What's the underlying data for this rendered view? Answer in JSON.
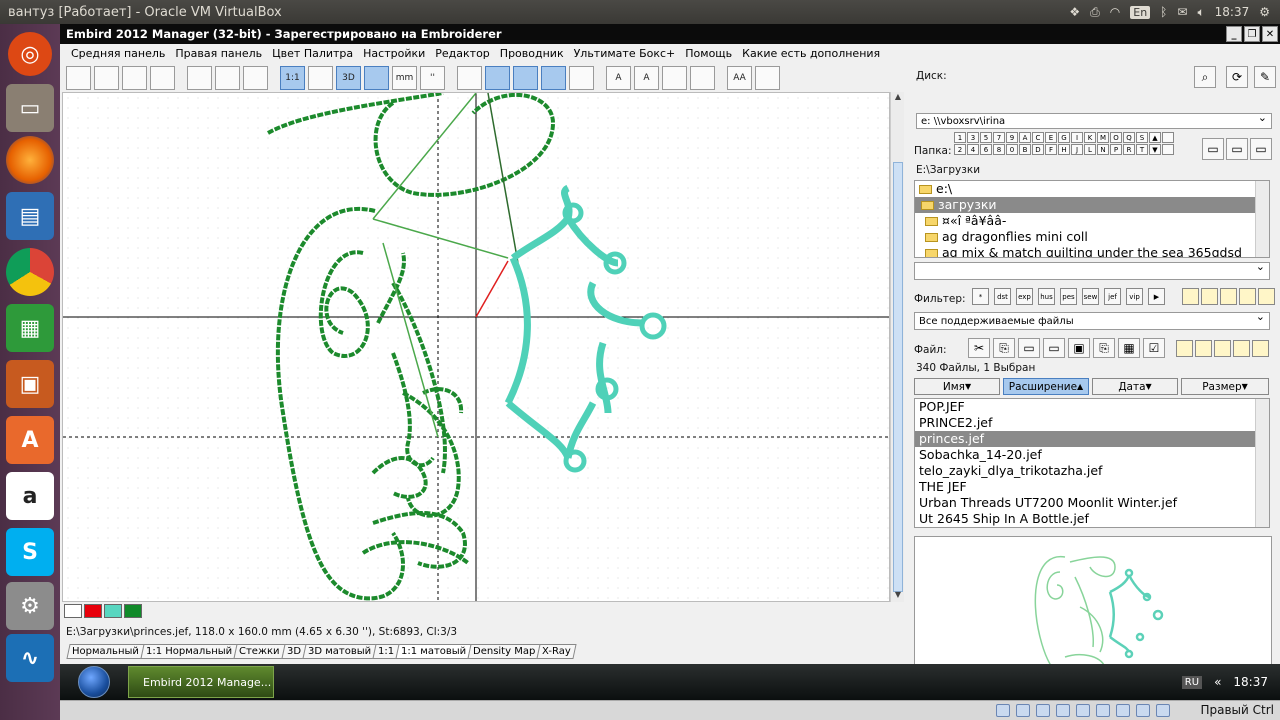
{
  "topbar": {
    "title": "вантуз [Работает] - Oracle VM VirtualBox",
    "keyboard_layout": "En",
    "clock": "18:37"
  },
  "launcher": {
    "apps": [
      "ubuntu-dash-icon",
      "files-icon",
      "firefox-icon",
      "writer-icon",
      "chrome-icon",
      "calc-icon",
      "impress-icon",
      "software-center-icon",
      "amazon-icon",
      "skype-icon",
      "settings-icon",
      "system-monitor-icon"
    ]
  },
  "app": {
    "title": "Embird 2012 Manager (32-bit) - Зарегестрировано на Embroiderer",
    "menu": [
      "Средняя панель",
      "Правая панель",
      "Цвет Палитра",
      "Настройки",
      "Редактор",
      "Проводник",
      "Ультимате Бокс+",
      "Помощь",
      "Какие есть дополнения"
    ],
    "toolbar": [
      {
        "name": "stitch-icon",
        "label": "",
        "on": false
      },
      {
        "name": "tools-icon",
        "label": "",
        "on": false
      },
      {
        "name": "camera-icon",
        "label": "",
        "on": false
      },
      {
        "name": "cross-tools-icon",
        "label": "",
        "on": false
      },
      {
        "name": "copy-icon",
        "label": "",
        "on": false
      },
      {
        "name": "print-icon",
        "label": "",
        "on": false
      },
      {
        "name": "preview-icon",
        "label": "",
        "on": false
      },
      {
        "name": "one-to-one-icon",
        "label": "1:1",
        "on": true
      },
      {
        "name": "blank-icon",
        "label": "",
        "on": false
      },
      {
        "name": "3d-icon",
        "label": "3D",
        "on": true
      },
      {
        "name": "3d-matte-icon",
        "label": "",
        "on": true
      },
      {
        "name": "ruler-mm-icon",
        "label": "mm",
        "on": false
      },
      {
        "name": "inches-icon",
        "label": "''",
        "on": false
      },
      {
        "name": "hoop-icon",
        "label": "",
        "on": false
      },
      {
        "name": "needle-icon",
        "label": "",
        "on": true
      },
      {
        "name": "eye-icon",
        "label": "",
        "on": true
      },
      {
        "name": "eye-alt-icon",
        "label": "",
        "on": true
      },
      {
        "name": "hand-icon",
        "label": "",
        "on": false
      },
      {
        "name": "font-icon",
        "label": "A",
        "on": false
      },
      {
        "name": "font-edit-icon",
        "label": "A",
        "on": false
      },
      {
        "name": "pages-icon",
        "label": "",
        "on": false
      },
      {
        "name": "tree-icon",
        "label": "",
        "on": false
      },
      {
        "name": "font-size-icon",
        "label": "AA",
        "on": false
      },
      {
        "name": "key-icon",
        "label": "",
        "on": false
      }
    ],
    "palette": [
      "#ffffff",
      "#e8000b",
      "#58d6c0",
      "#118a2a"
    ],
    "status": "E:\\Загрузки\\princes.jef, 118.0 x 160.0 mm (4.65 x 6.30 ''), St:6893, Cl:3/3",
    "view_tabs": [
      "Нормальный",
      "1:1 Нормальный",
      "Стежки",
      "3D",
      "3D матовый",
      "1:1",
      "1:1 матовый",
      "Density Map",
      "X-Ray"
    ]
  },
  "right": {
    "disk_label": "Диск:",
    "disk_value": "e: \\\\vboxsrv\\irina",
    "folder_label": "Папка:",
    "folder_buttons_row1": [
      "1",
      "3",
      "5",
      "7",
      "9",
      "A",
      "C",
      "E",
      "G",
      "I",
      "K",
      "M",
      "O",
      "Q",
      "S",
      "▲"
    ],
    "folder_buttons_row2": [
      "2",
      "4",
      "6",
      "8",
      "0",
      "B",
      "D",
      "F",
      "H",
      "J",
      "L",
      "N",
      "P",
      "R",
      "T",
      "▼"
    ],
    "current_path": "E:\\Загрузки",
    "folders": [
      "e:\\",
      "загрузки",
      "¤«î ªâ¥ââ-",
      "ag dragonflies mini coll",
      "ag mix & match quilting under the sea 365gdsd"
    ],
    "filter_label": "Фильтер:",
    "filter_buttons": [
      "*",
      "dst",
      "exp",
      "hus",
      "pes",
      "sew",
      "jef",
      "vip",
      "▶"
    ],
    "file_type": "Все поддерживаемые файлы",
    "file_label": "Файл:",
    "file_count": "340 Файлы, 1 Выбран",
    "sort": [
      {
        "label": "Имя",
        "on": false
      },
      {
        "label": "Расширение",
        "on": true
      },
      {
        "label": "Дата",
        "on": false
      },
      {
        "label": "Размер",
        "on": false
      }
    ],
    "files": [
      "POP.JEF",
      "PRINCE2.jef",
      "princes.jef",
      "Sobachka_14-20.jef",
      "telo_zayki_dlya_trikotazha.jef",
      "THE JEF",
      "Urban Threads UT7200 Moonlit Winter.jef",
      "Ut 2645 Ship In A Bottle.jef"
    ],
    "selected_file": "princes.jef"
  },
  "win_taskbar": {
    "task": "Embird 2012 Manage...",
    "lang": "RU",
    "clock": "18:37"
  },
  "vb_status": {
    "hostkey": "Правый Ctrl"
  }
}
